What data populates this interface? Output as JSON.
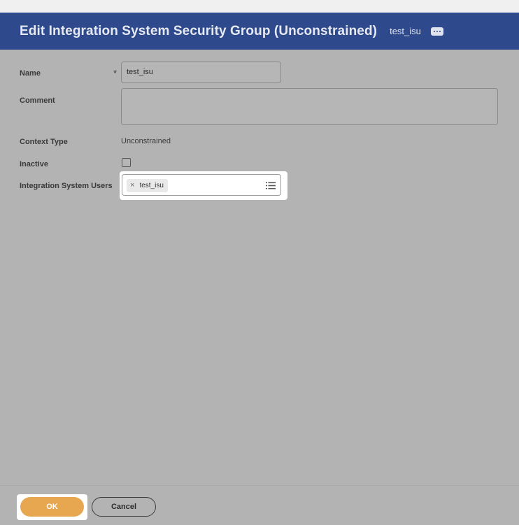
{
  "header": {
    "title": "Edit Integration System Security Group (Unconstrained)",
    "object_name": "test_isu",
    "related_actions_icon": "ellipsis-icon",
    "bar_color": "#2e4a8c"
  },
  "form": {
    "name": {
      "label": "Name",
      "required_marker": "*",
      "value": "test_isu"
    },
    "comment": {
      "label": "Comment",
      "value": ""
    },
    "context_type": {
      "label": "Context Type",
      "value": "Unconstrained"
    },
    "inactive": {
      "label": "Inactive",
      "checked": false
    },
    "integration_system_users": {
      "label": "Integration System Users",
      "selected": [
        "test_isu"
      ],
      "remove_icon": "close-icon",
      "prompt_icon": "list-icon"
    }
  },
  "footer": {
    "ok_label": "OK",
    "cancel_label": "Cancel",
    "ok_color": "#e7a751"
  }
}
